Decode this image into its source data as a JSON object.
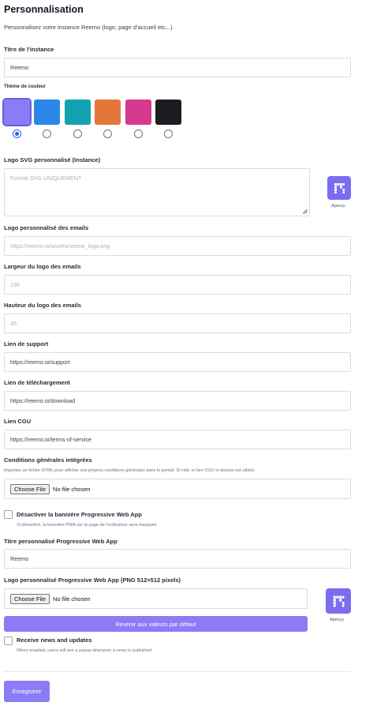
{
  "header": {
    "title": "Personnalisation",
    "subtitle": "Personnalisez votre instance Reemo (logo, page d'accueil etc...)"
  },
  "instance_title": {
    "label": "Titre de l'instance",
    "value": "Reemo"
  },
  "theme": {
    "label": "Thème de couleur",
    "colors": [
      "#8b7cf6",
      "#2b86e7",
      "#12a3ae",
      "#e5763a",
      "#d63a8e",
      "#1c1c22"
    ],
    "selected_index": 0
  },
  "svg_logo": {
    "label": "Logo SVG personnalisé (Instance)",
    "placeholder": "Format SVG UNIQUEMENT",
    "preview_label": "Aperçu"
  },
  "email_logo": {
    "label": "Logo personnalisé des emails",
    "placeholder": "https://reemo.io/assets/reemo_logo.png"
  },
  "email_logo_width": {
    "label": "Largeur du logo des emails",
    "placeholder": "136"
  },
  "email_logo_height": {
    "label": "Hauteur du logo des emails",
    "placeholder": "45"
  },
  "support_link": {
    "label": "Lien de support",
    "value": "https://reemo.io/support"
  },
  "download_link": {
    "label": "Lien de téléchargement",
    "value": "https://reemo.io/download"
  },
  "cgu_link": {
    "label": "Lien CGU",
    "value": "https://reemo.io/terms-of-service"
  },
  "integrated_terms": {
    "label": "Conditions générales intégrées",
    "help": "Importez un fichier HTML pour afficher vos propres conditions générales dans le portail. Si vide, le lien CGU ci-dessus est utilisé.",
    "file_button": "Choose File",
    "file_status": "No file chosen"
  },
  "pwa_banner": {
    "label": "Désactiver la bannière Progressive Web App",
    "help": "Si désactivé, la bannière PWA sur la page de l'ordinateur sera masquée",
    "checked": false
  },
  "pwa_title": {
    "label": "Titre personnalisé Progressive Web App",
    "value": "Reemo"
  },
  "pwa_logo": {
    "label": "Logo personnalisé Progressive Web App (PNG 512×512 pixels)",
    "file_button": "Choose File",
    "file_status": "No file chosen",
    "preview_label": "Aperçu"
  },
  "reset_button": "Revenir aux valeurs par défaut",
  "news": {
    "label": "Receive news and updates",
    "help": "When enabled, users will see a popup whenever a news is published.",
    "checked": false
  },
  "save_button": "Enregistrer"
}
